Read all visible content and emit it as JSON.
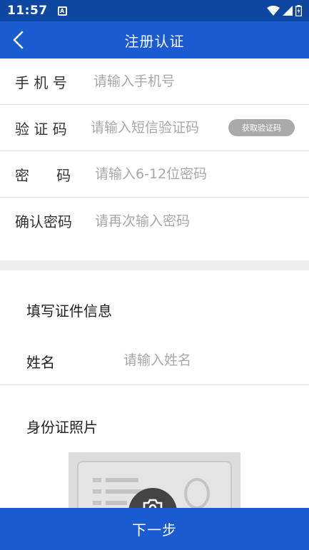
{
  "status_bar": {
    "time": "11:57",
    "notification_icon": "a-notification-icon",
    "icons": [
      "wifi-icon",
      "signal-icon",
      "battery-icon"
    ]
  },
  "header": {
    "title": "注册认证",
    "back_icon": "chevron-left-icon"
  },
  "form": {
    "phone": {
      "label": "手 机 号",
      "placeholder": "请输入手机号"
    },
    "code": {
      "label": "验 证 码",
      "placeholder": "请输入短信验证码",
      "button": "获取验证码"
    },
    "password": {
      "label": "密      码",
      "placeholder": "请输入6-12位密码"
    },
    "confirm": {
      "label": "确认密码",
      "placeholder": "请再次输入密码"
    }
  },
  "id_section": {
    "title": "填写证件信息",
    "name": {
      "label": "姓名",
      "placeholder": "请输入姓名"
    },
    "photo_title": "身份证照片",
    "photo_icon": "camera-icon"
  },
  "footer": {
    "next_label": "下一步"
  },
  "colors": {
    "primary": "#1a5bd1",
    "status_bar": "#0d47a1",
    "placeholder": "#a8a8a8",
    "divider": "#e0e0e0",
    "band": "#eeeeee",
    "code_button": "#aaaaaa"
  }
}
